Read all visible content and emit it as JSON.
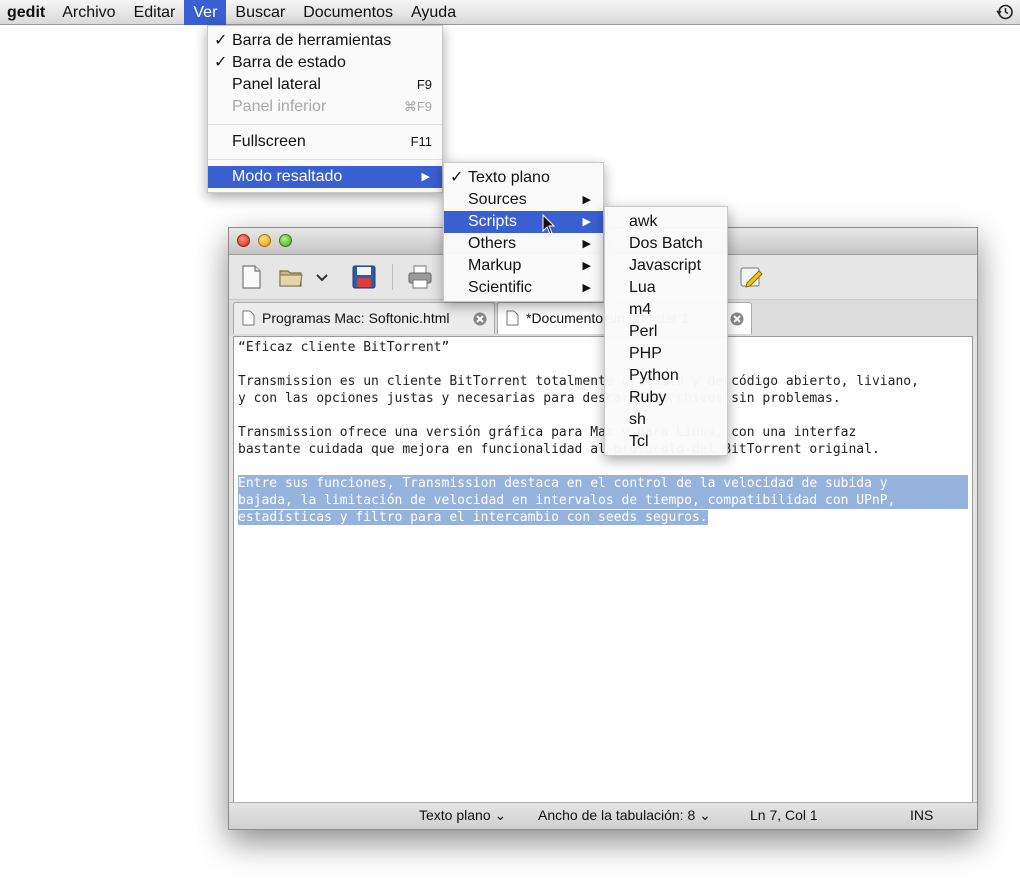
{
  "menubar": {
    "app": "gedit",
    "items": [
      "Archivo",
      "Editar",
      "Ver",
      "Buscar",
      "Documentos",
      "Ayuda"
    ],
    "active": "Ver"
  },
  "ver_menu": {
    "items": [
      {
        "label": "Barra de herramientas",
        "checked": true,
        "shortcut": ""
      },
      {
        "label": "Barra de estado",
        "checked": true,
        "shortcut": ""
      },
      {
        "label": "Panel lateral",
        "checked": false,
        "shortcut": "F9"
      },
      {
        "label": "Panel inferior",
        "checked": false,
        "shortcut": "⌘F9",
        "disabled": true
      },
      {
        "label": "Fullscreen",
        "checked": false,
        "shortcut": "F11"
      },
      {
        "label": "Modo resaltado",
        "checked": false,
        "submenu": true,
        "highlighted": true
      }
    ]
  },
  "highlight_menu": {
    "items": [
      {
        "label": "Texto plano",
        "checked": true
      },
      {
        "label": "Sources",
        "submenu": true
      },
      {
        "label": "Scripts",
        "submenu": true,
        "highlighted": true
      },
      {
        "label": "Others",
        "submenu": true
      },
      {
        "label": "Markup",
        "submenu": true
      },
      {
        "label": "Scientific",
        "submenu": true
      }
    ]
  },
  "scripts_menu": {
    "items": [
      "awk",
      "Dos Batch",
      "Javascript",
      "Lua",
      "m4",
      "Perl",
      "PHP",
      "Python",
      "Ruby",
      "sh",
      "Tcl"
    ]
  },
  "tabs": [
    {
      "label": "Programas Mac: Softonic.html"
    },
    {
      "label": "*Documento sin guardar 1"
    }
  ],
  "editor": {
    "lines": [
      "“Eficaz cliente BitTorrent”",
      "",
      "Transmission es un cliente BitTorrent totalmente gratuito y de código abierto, liviano,",
      "y con las opciones justas y necesarias para descargar archivos sin problemas.",
      "",
      "Transmission ofrece una versión gráfica para Mac y para Linux, con una interfaz",
      "bastante cuidada que mejora en funcionalidad al protocolo del BitTorrent original.",
      "",
      "Entre sus funciones, Transmission destaca en el control de la velocidad de subida y",
      "bajada, la limitación de velocidad en intervalos de tiempo, compatibilidad con UPnP,",
      "estadísticas y filtro para el intercambio con seeds seguros."
    ]
  },
  "statusbar": {
    "mode": "Texto plano",
    "tab_width": "Ancho de la tabulación:  8",
    "position": "Ln 7, Col 1",
    "insert": "INS"
  },
  "colors": {
    "menu_highlight": "#3a5fd0",
    "selection": "#95b3dd"
  }
}
